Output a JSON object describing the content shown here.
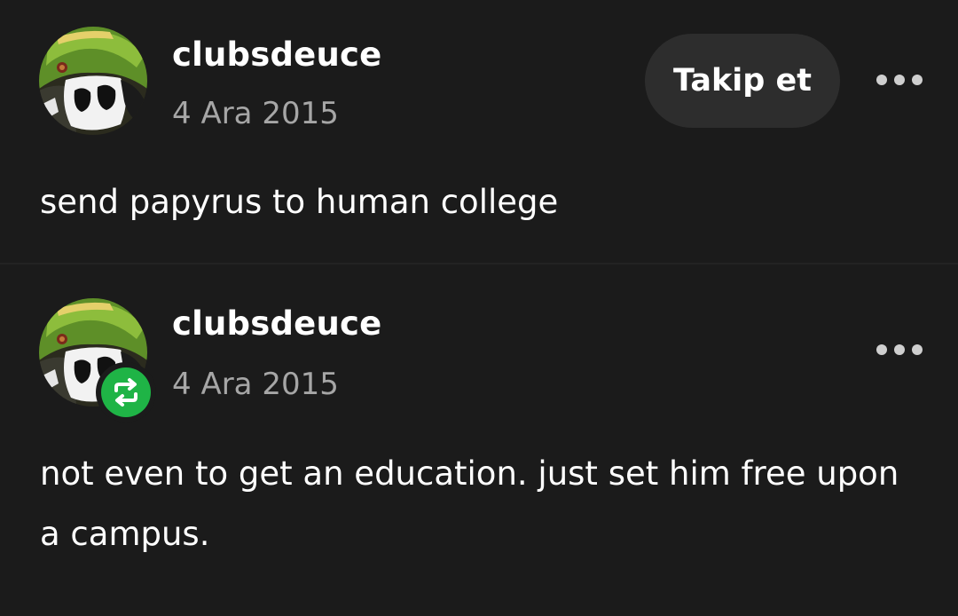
{
  "posts": [
    {
      "username": "clubsdeuce",
      "date": "4 Ara 2015",
      "text": "send papyrus to human college",
      "follow_label": "Takip et",
      "avatar_icon": "avatar-image",
      "more_icon": "more-options-icon"
    },
    {
      "username": "clubsdeuce",
      "date": "4 Ara 2015",
      "text": "not even to get an education. just set him free upon a campus.",
      "avatar_icon": "avatar-image",
      "badge_icon": "reblog-icon",
      "more_icon": "more-options-icon"
    }
  ],
  "colors": {
    "background": "#1b1b1b",
    "button_background": "#2d2d2d",
    "muted_text": "#a6a6a6",
    "reblog_green": "#1fb446"
  }
}
